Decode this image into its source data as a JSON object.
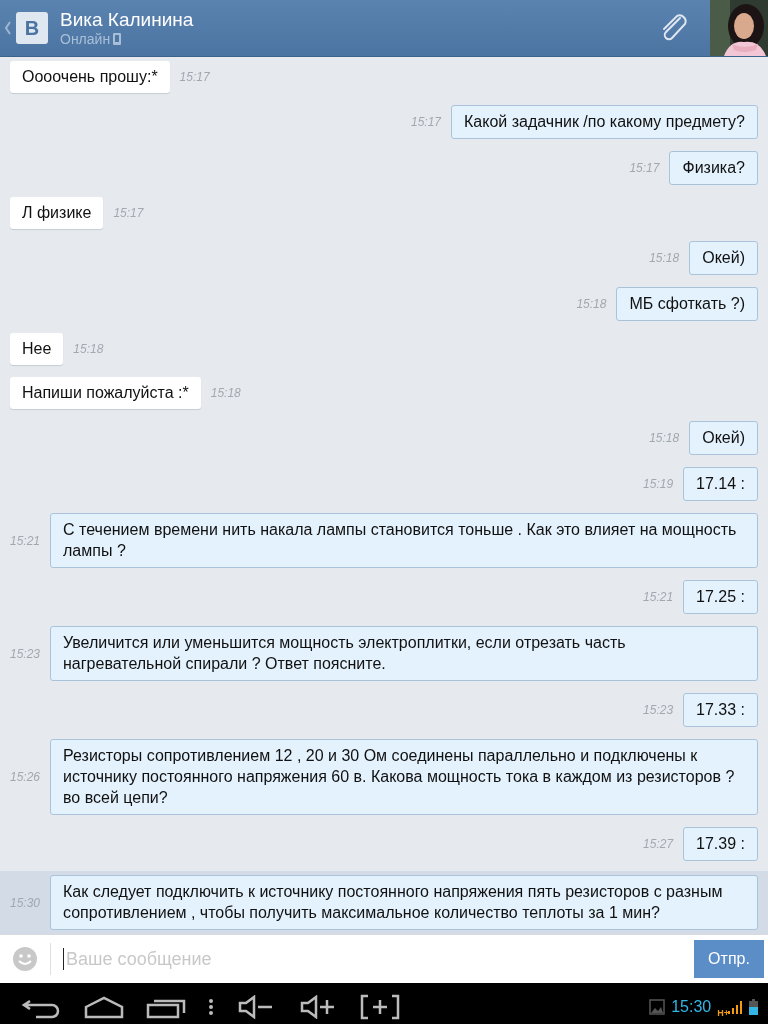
{
  "header": {
    "name": "Вика Калинина",
    "status": "Онлайн",
    "logo": "В"
  },
  "messages": [
    {
      "kind": "incoming",
      "text": "Оооочень прошу:*",
      "time": "15:17",
      "highlighted": false
    },
    {
      "kind": "outgoing",
      "text": "Какой задачник /по какому предмету?",
      "time": "15:17",
      "highlighted": false
    },
    {
      "kind": "outgoing",
      "text": "Физика?",
      "time": "15:17",
      "highlighted": false
    },
    {
      "kind": "incoming",
      "text": "Л физике",
      "time": "15:17",
      "highlighted": false
    },
    {
      "kind": "outgoing",
      "text": "Окей)",
      "time": "15:18",
      "highlighted": false
    },
    {
      "kind": "outgoing",
      "text": "МБ сфоткать ?)",
      "time": "15:18",
      "highlighted": false
    },
    {
      "kind": "incoming",
      "text": "Нее",
      "time": "15:18",
      "highlighted": false
    },
    {
      "kind": "incoming",
      "text": "Напиши пожалуйста :*",
      "time": "15:18",
      "highlighted": false
    },
    {
      "kind": "outgoing",
      "text": "Окей)",
      "time": "15:18",
      "highlighted": false
    },
    {
      "kind": "outgoing",
      "text": "17.14 :",
      "time": "15:19",
      "highlighted": false
    },
    {
      "kind": "outgoing",
      "text": "С течением времени нить накала лампы становится тоньше . Как это влияет на мощность лампы ?",
      "time": "15:21",
      "highlighted": false
    },
    {
      "kind": "outgoing",
      "text": "17.25 :",
      "time": "15:21",
      "highlighted": false
    },
    {
      "kind": "outgoing",
      "text": "Увеличится или уменьшится мощность электроплитки, если отрезать часть нагревательной спирали ? Ответ поясните.",
      "time": "15:23",
      "highlighted": false
    },
    {
      "kind": "outgoing",
      "text": "17.33 :",
      "time": "15:23",
      "highlighted": false
    },
    {
      "kind": "outgoing",
      "text": "Резисторы сопротивлением 12 , 20 и 30 Ом соединены параллельно и подключены к источнику постоянного напряжения 60 в. Какова мощность тока в каждом из резисторов ? во всей цепи?",
      "time": "15:26",
      "highlighted": false
    },
    {
      "kind": "outgoing",
      "text": "17.39 :",
      "time": "15:27",
      "highlighted": false
    },
    {
      "kind": "outgoing",
      "text": "Как следует подключить к источнику постоянного напряжения пять резисторов с разным сопротивлением , чтобы получить максимальное количество теплоты за 1 мин?",
      "time": "15:30",
      "highlighted": true
    }
  ],
  "composer": {
    "placeholder": "Ваше сообщение",
    "send": "Отпр."
  },
  "system_bar": {
    "time": "15:30",
    "network": "H+"
  }
}
